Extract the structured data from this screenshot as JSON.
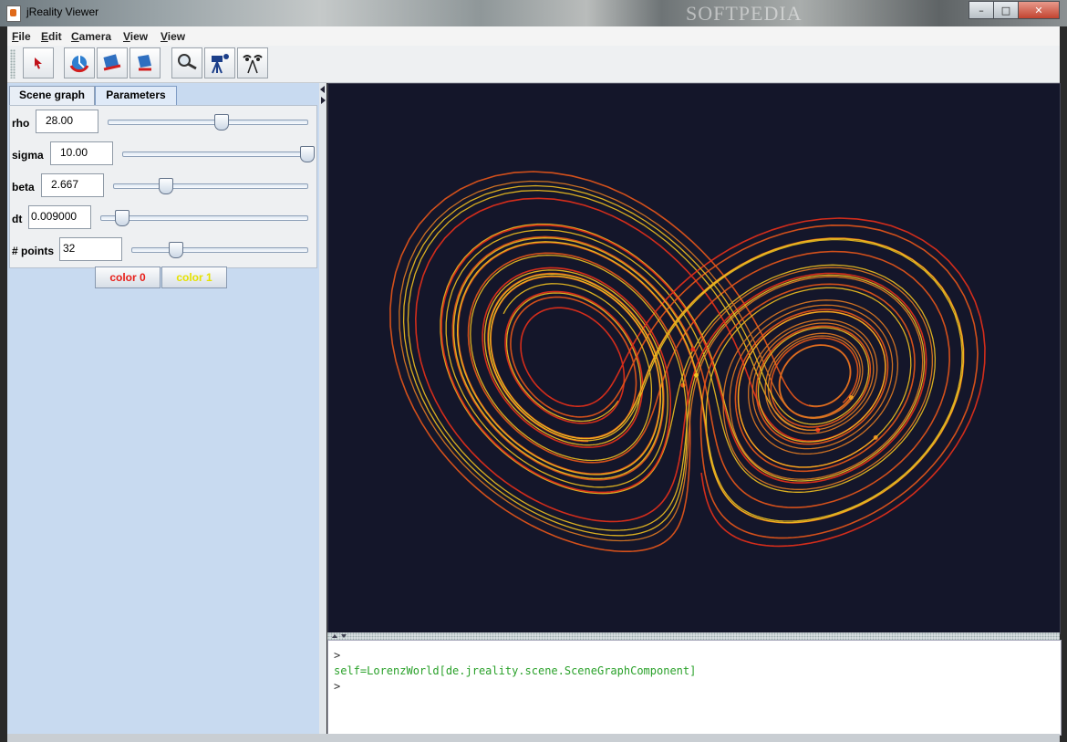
{
  "window": {
    "title": "jReality Viewer",
    "watermark": "SOFTPEDIA",
    "controls": [
      "minimize",
      "maximize",
      "close"
    ]
  },
  "menu": {
    "items": [
      {
        "label": "File",
        "mnemonic": "F",
        "rest": "ile"
      },
      {
        "label": "Edit",
        "mnemonic": "E",
        "rest": "dit"
      },
      {
        "label": "Camera",
        "mnemonic": "C",
        "rest": "amera"
      },
      {
        "label": "View",
        "mnemonic": "V",
        "rest": "iew"
      },
      {
        "label": "View",
        "mnemonic": "V",
        "rest": "iew"
      }
    ]
  },
  "toolbar": {
    "buttons": [
      {
        "icon": "pointer-arrow-icon"
      },
      {
        "icon": "rotate-tool-icon"
      },
      {
        "icon": "translate-tool-icon"
      },
      {
        "icon": "drag-tool-icon"
      },
      {
        "icon": "zoom-magnifier-icon"
      },
      {
        "icon": "camera-tripod-icon"
      },
      {
        "icon": "stereo-eyes-icon"
      }
    ]
  },
  "left_panel": {
    "tabs": [
      {
        "label": "Scene graph",
        "active": false
      },
      {
        "label": "Parameters",
        "active": true
      }
    ],
    "parameters": [
      {
        "label": "rho",
        "value": "28.00",
        "slider_fraction": 0.57
      },
      {
        "label": "sigma",
        "value": "10.00",
        "slider_fraction": 1.0
      },
      {
        "label": "beta",
        "value": "2.667",
        "slider_fraction": 0.27
      },
      {
        "label": "dt",
        "value": "0.009000",
        "slider_fraction": 0.1
      },
      {
        "label": "# points",
        "value": "32",
        "slider_fraction": 0.25
      }
    ],
    "color_buttons": [
      {
        "label": "color 0",
        "color": "#e8201a"
      },
      {
        "label": "color 1",
        "color": "#e6e200"
      }
    ]
  },
  "viewer": {
    "background": "#14162a",
    "curve_colors": [
      "#e8561a",
      "#f0c020",
      "#e8301a",
      "#e07a22"
    ]
  },
  "console": {
    "lines": [
      {
        "kind": "prompt",
        "text": ">"
      },
      {
        "kind": "output",
        "text": "self=LorenzWorld[de.jreality.scene.SceneGraphComponent]"
      },
      {
        "kind": "prompt",
        "text": ">"
      }
    ]
  }
}
